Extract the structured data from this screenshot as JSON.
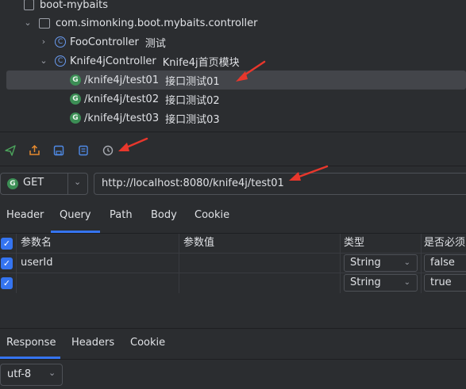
{
  "tree": {
    "root": "boot-mybaits",
    "package": "com.simonking.boot.mybaits.controller",
    "nodes": [
      {
        "icon": "C",
        "label": "FooController",
        "desc": "测试"
      },
      {
        "icon": "C",
        "label": "Knife4jController",
        "desc": "Knife4j首页模块"
      }
    ],
    "endpoints": [
      {
        "icon": "G",
        "path": "/knife4j/test01",
        "desc": "接口测试01"
      },
      {
        "icon": "G",
        "path": "/knife4j/test02",
        "desc": "接口测试02"
      },
      {
        "icon": "G",
        "path": "/knife4j/test03",
        "desc": "接口测试03"
      }
    ]
  },
  "request": {
    "method": "GET",
    "method_icon": "G",
    "url": "http://localhost:8080/knife4j/test01"
  },
  "request_tabs": [
    "Header",
    "Query",
    "Path",
    "Body",
    "Cookie"
  ],
  "active_request_tab": "Query",
  "params": {
    "headers": [
      "参数名",
      "参数值",
      "类型",
      "是否必须"
    ],
    "rows": [
      {
        "checked": true,
        "name": "userId",
        "value": "",
        "type": "String",
        "required": "false"
      },
      {
        "checked": true,
        "name": "",
        "value": "",
        "type": "String",
        "required": "true"
      }
    ]
  },
  "response_tabs": [
    "Response",
    "Headers",
    "Cookie"
  ],
  "active_response_tab": "Response",
  "encoding": "utf-8",
  "colors": {
    "accent": "#3574f0",
    "selected_row": "#43454a",
    "arrow": "#e8372c"
  }
}
